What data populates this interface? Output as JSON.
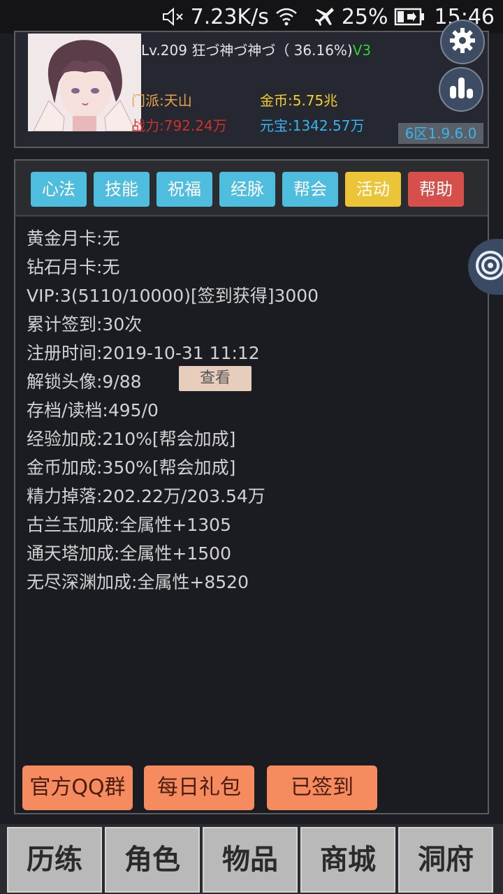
{
  "status_bar": {
    "net_speed": "7.23K/s",
    "battery": "25%",
    "time": "15:46"
  },
  "profile": {
    "level_line": "Lv.209 狂づ神づ神づ（ 36.16%)",
    "vip_badge": "V3",
    "sect": "门派:天山",
    "gold": "金币:5.75兆",
    "power": "战力:792.24万",
    "ingot": "元宝:1342.57万",
    "server": "6区1.9.6.0"
  },
  "tabs": [
    {
      "label": "心法",
      "color": "blue"
    },
    {
      "label": "技能",
      "color": "blue"
    },
    {
      "label": "祝福",
      "color": "blue"
    },
    {
      "label": "经脉",
      "color": "blue"
    },
    {
      "label": "帮会",
      "color": "blue"
    },
    {
      "label": "活动",
      "color": "yellow"
    },
    {
      "label": "帮助",
      "color": "red"
    }
  ],
  "stats": [
    "黄金月卡:无",
    "钻石月卡:无",
    "VIP:3(5110/10000)[签到获得]3000",
    "累计签到:30次",
    "注册时间:2019-10-31 11:12",
    "解锁头像:9/88",
    "存档/读档:495/0",
    "经验加成:210%[帮会加成]",
    "金币加成:350%[帮会加成]",
    "精力掉落:202.22万/203.54万",
    "古兰玉加成:全属性+1305",
    "通天塔加成:全属性+1500",
    "无尽深渊加成:全属性+8520"
  ],
  "view_button": "查看",
  "actions": {
    "qq_group": "官方QQ群",
    "daily_gift": "每日礼包",
    "signed_in": "已签到"
  },
  "bottom_nav": [
    "历练",
    "角色",
    "物品",
    "商城",
    "洞府"
  ],
  "colors": {
    "tab_blue": "#4fbede",
    "tab_yellow": "#ecc437",
    "tab_red": "#d64f4a",
    "action_orange": "#f58b5f"
  },
  "icons": [
    "mute-icon",
    "wifi-icon",
    "airplane-icon",
    "battery-icon",
    "gear-icon",
    "bar-chart-icon",
    "ring-icon"
  ]
}
